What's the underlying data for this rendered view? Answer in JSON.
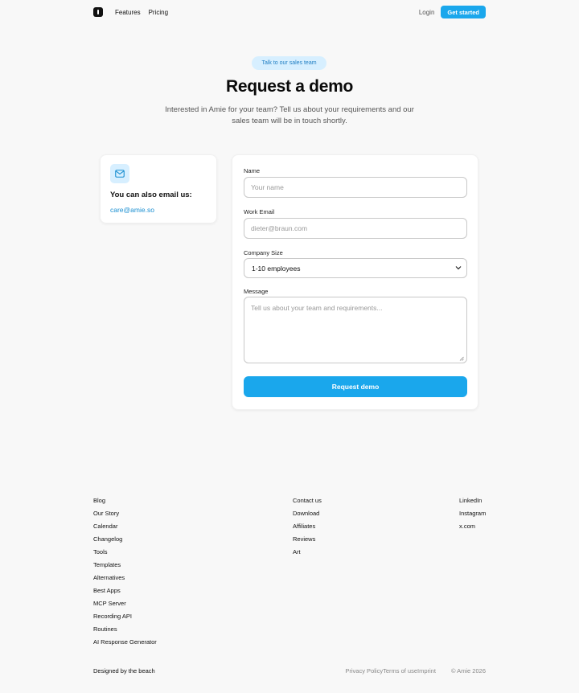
{
  "nav": {
    "logo": "amie-logo",
    "links": [
      "Features",
      "Pricing"
    ],
    "login": "Login",
    "cta": "Get started"
  },
  "hero": {
    "badge": "Talk to our sales team",
    "title": "Request a demo",
    "subtitle": "Interested in Amie for your team? Tell us about your requirements and our sales team will be in touch shortly."
  },
  "email_card": {
    "icon": "mail-icon",
    "title": "You can also email us:",
    "email": "care@amie.so"
  },
  "form": {
    "name_label": "Name",
    "name_placeholder": "Your name",
    "email_label": "Work Email",
    "email_placeholder": "dieter@braun.com",
    "size_label": "Company Size",
    "size_value": "1-10 employees",
    "message_label": "Message",
    "message_placeholder": "Tell us about your team and requirements...",
    "submit": "Request demo"
  },
  "footer": {
    "col1": [
      "Blog",
      "Our Story",
      "Calendar",
      "Changelog",
      "Tools",
      "Templates",
      "Alternatives",
      "Best Apps",
      "MCP Server",
      "Recording API",
      "Routines",
      "AI Response Generator"
    ],
    "col2": [
      "Contact us",
      "Download",
      "Affiliates",
      "Reviews",
      "Art"
    ],
    "col3": [
      "LinkedIn",
      "Instagram",
      "x.com"
    ],
    "designed": "Designed by the beach",
    "legal": [
      "Privacy Policy",
      "Terms of use",
      "Imprint",
      "© Amie 2026"
    ]
  },
  "colors": {
    "accent": "#1aa7ec",
    "badge_bg": "#d7efff",
    "badge_text": "#2380c4",
    "link": "#1a8fd1",
    "background": "#f8f8f8"
  }
}
